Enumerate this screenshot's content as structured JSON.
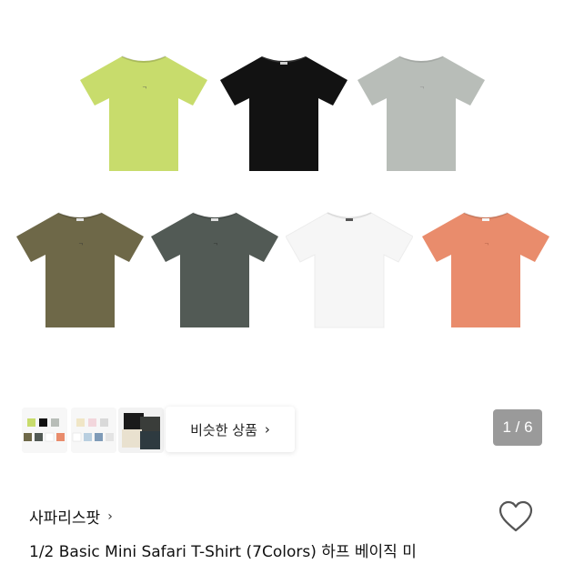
{
  "gallery": {
    "shirts": [
      {
        "color_name": "lime",
        "color": "#c8dc6c"
      },
      {
        "color_name": "black",
        "color": "#121212"
      },
      {
        "color_name": "gray",
        "color": "#b8bdb8"
      },
      {
        "color_name": "khaki",
        "color": "#6e6848"
      },
      {
        "color_name": "charcoal",
        "color": "#525a55"
      },
      {
        "color_name": "white",
        "color": "#f6f6f6"
      },
      {
        "color_name": "coral",
        "color": "#e98c6c"
      }
    ],
    "thumbnails": [
      {
        "name": "thumb-colors-1"
      },
      {
        "name": "thumb-colors-2"
      },
      {
        "name": "thumb-colors-3"
      }
    ],
    "similar_label": "비슷한 상품",
    "similar_chevron": "›",
    "pager": "1 / 6"
  },
  "product": {
    "brand": "사파리스팟",
    "brand_chevron": "›",
    "title": "1/2 Basic Mini Safari T-Shirt (7Colors) 하프 베이직 미"
  },
  "icons": {
    "heart": "heart-icon",
    "chevron": "chevron-right-icon"
  }
}
